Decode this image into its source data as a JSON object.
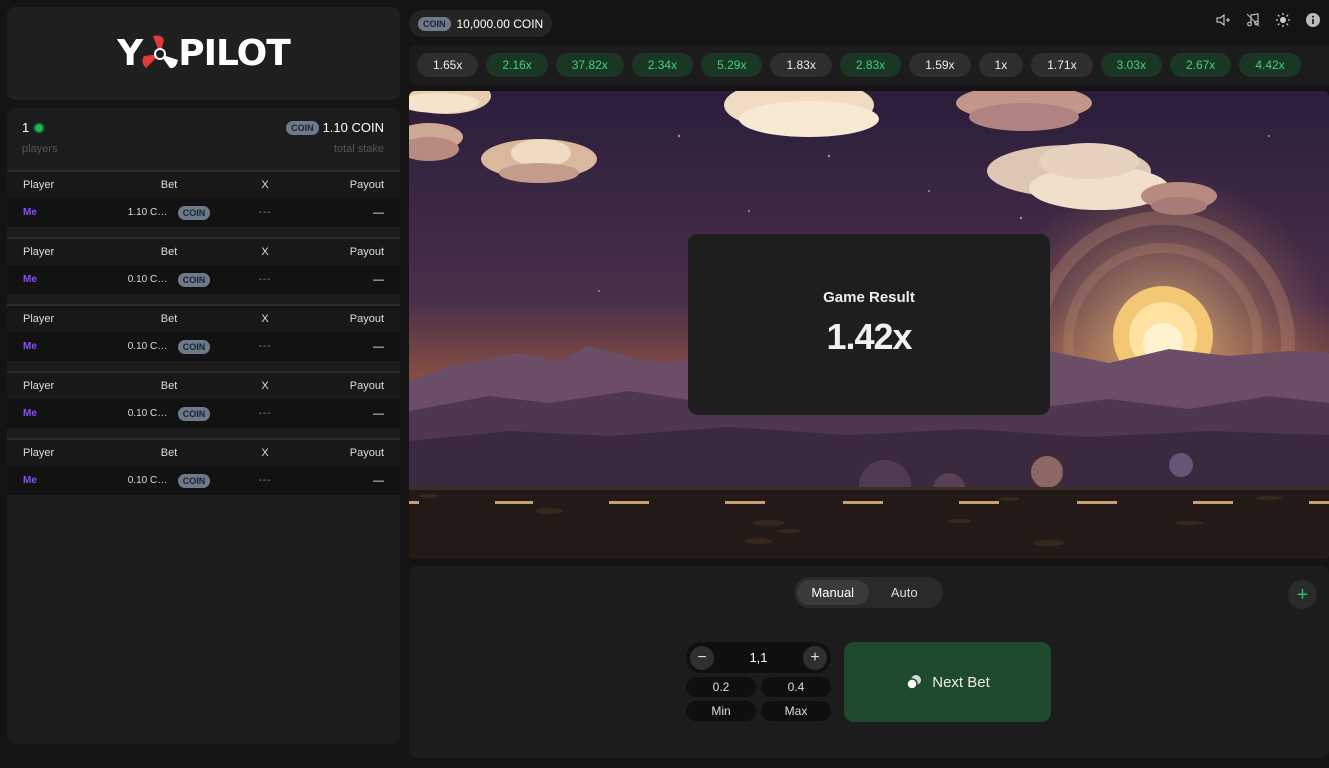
{
  "brand": {
    "logo_text_left": "Y",
    "logo_text_right": "PILOT"
  },
  "balance": {
    "currency": "COIN",
    "amount": "10,000.00 COIN"
  },
  "top_icons": [
    "sound-icon",
    "music-icon",
    "brightness-icon",
    "info-icon"
  ],
  "history": [
    {
      "value": "1.65x",
      "tier": "low"
    },
    {
      "value": "2.16x",
      "tier": "high"
    },
    {
      "value": "37.82x",
      "tier": "high"
    },
    {
      "value": "2.34x",
      "tier": "high"
    },
    {
      "value": "5.29x",
      "tier": "high"
    },
    {
      "value": "1.83x",
      "tier": "low"
    },
    {
      "value": "2.83x",
      "tier": "high"
    },
    {
      "value": "1.59x",
      "tier": "low"
    },
    {
      "value": "1x",
      "tier": "low"
    },
    {
      "value": "1.71x",
      "tier": "low"
    },
    {
      "value": "3.03x",
      "tier": "high"
    },
    {
      "value": "2.67x",
      "tier": "high"
    },
    {
      "value": "4.42x",
      "tier": "high"
    }
  ],
  "stats": {
    "players_count": "1",
    "players_label": "players",
    "stake_currency": "COIN",
    "stake_amount": "1.10 COIN",
    "stake_label": "total stake"
  },
  "bet_columns": {
    "player": "Player",
    "bet": "Bet",
    "x": "X",
    "payout": "Payout"
  },
  "bets": [
    {
      "player": "Me",
      "bet": "1.10 COIN",
      "currency": "COIN",
      "x": "---",
      "payout": "—"
    },
    {
      "player": "Me",
      "bet": "0.10 COIN",
      "currency": "COIN",
      "x": "---",
      "payout": "—"
    },
    {
      "player": "Me",
      "bet": "0.10 COIN",
      "currency": "COIN",
      "x": "---",
      "payout": "—"
    },
    {
      "player": "Me",
      "bet": "0.10 COIN",
      "currency": "COIN",
      "x": "---",
      "payout": "—"
    },
    {
      "player": "Me",
      "bet": "0.10 COIN",
      "currency": "COIN",
      "x": "---",
      "payout": "—"
    }
  ],
  "result": {
    "title": "Game Result",
    "multiplier": "1.42x"
  },
  "mode_tabs": {
    "manual": "Manual",
    "auto": "Auto",
    "active": "manual"
  },
  "bet_input": {
    "value": "1,1",
    "minus": "−",
    "plus": "+"
  },
  "quick_amounts": {
    "a": "0.2",
    "b": "0.4",
    "min": "Min",
    "max": "Max"
  },
  "next_bet": {
    "label": "Next Bet"
  },
  "add_panel": "+",
  "colors": {
    "accent_green": "#3fd37a",
    "me_purple": "#8a4dff",
    "next_bet_bg": "#1e4a2d"
  }
}
